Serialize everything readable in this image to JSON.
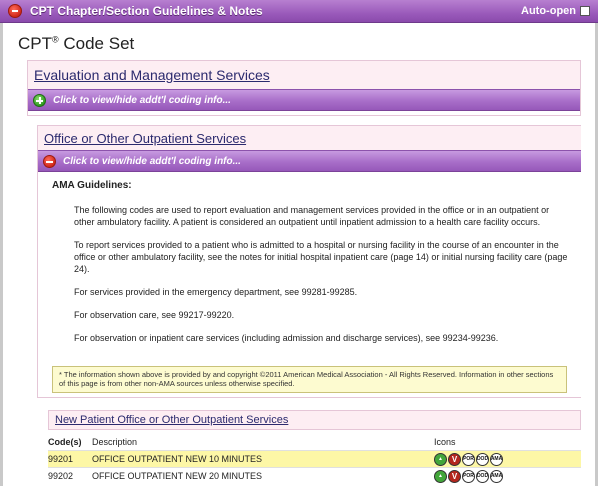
{
  "header": {
    "title": "CPT Chapter/Section Guidelines & Notes",
    "autoopen_label": "Auto-open"
  },
  "codeset": {
    "title": "CPT",
    "reg": "®",
    "suffix": " Code Set"
  },
  "section1": {
    "title": "Evaluation and Management Services",
    "toggle": "Click to view/hide addt'l coding info..."
  },
  "section2": {
    "title": "Office or Other Outpatient Services",
    "toggle": "Click to view/hide addt'l coding info..."
  },
  "guidelines": {
    "heading": "AMA Guidelines:",
    "paragraphs": [
      "The following codes are used to report evaluation and management services provided in the office or in an outpatient or other ambulatory facility. A patient is considered an outpatient until inpatient admission to a health care facility occurs.",
      "To report services provided to a patient who is admitted to a hospital or nursing facility in the course of an encounter in the office or other ambulatory facility, see the notes for initial hospital inpatient care (page 14) or initial nursing facility care (page 24).",
      "For services provided in the emergency department, see 99281-99285.",
      "For observation care, see 99217-99220.",
      "For observation or inpatient care services (including admission and discharge services), see 99234-99236."
    ]
  },
  "notice": "* The information shown above is provided by and copyright ©2011 American Medical Association - All Rights Reserved.  Information in other sections of this page is from other non-AMA sources unless otherwise specified.",
  "subsection": {
    "title": "New Patient Office or Other Outpatient Services"
  },
  "table": {
    "headers": {
      "code": "Code(s)",
      "desc": "Description",
      "icons": "Icons"
    },
    "rows": [
      {
        "code": "99201",
        "desc": "OFFICE OUTPATIENT NEW 10 MINUTES",
        "icons": [
          "▲",
          "V",
          "POR",
          "DOD",
          "AMA"
        ]
      },
      {
        "code": "99202",
        "desc": "OFFICE OUTPATIENT NEW 20 MINUTES",
        "icons": [
          "▲",
          "V",
          "POR",
          "DOD",
          "AMA"
        ]
      }
    ]
  }
}
